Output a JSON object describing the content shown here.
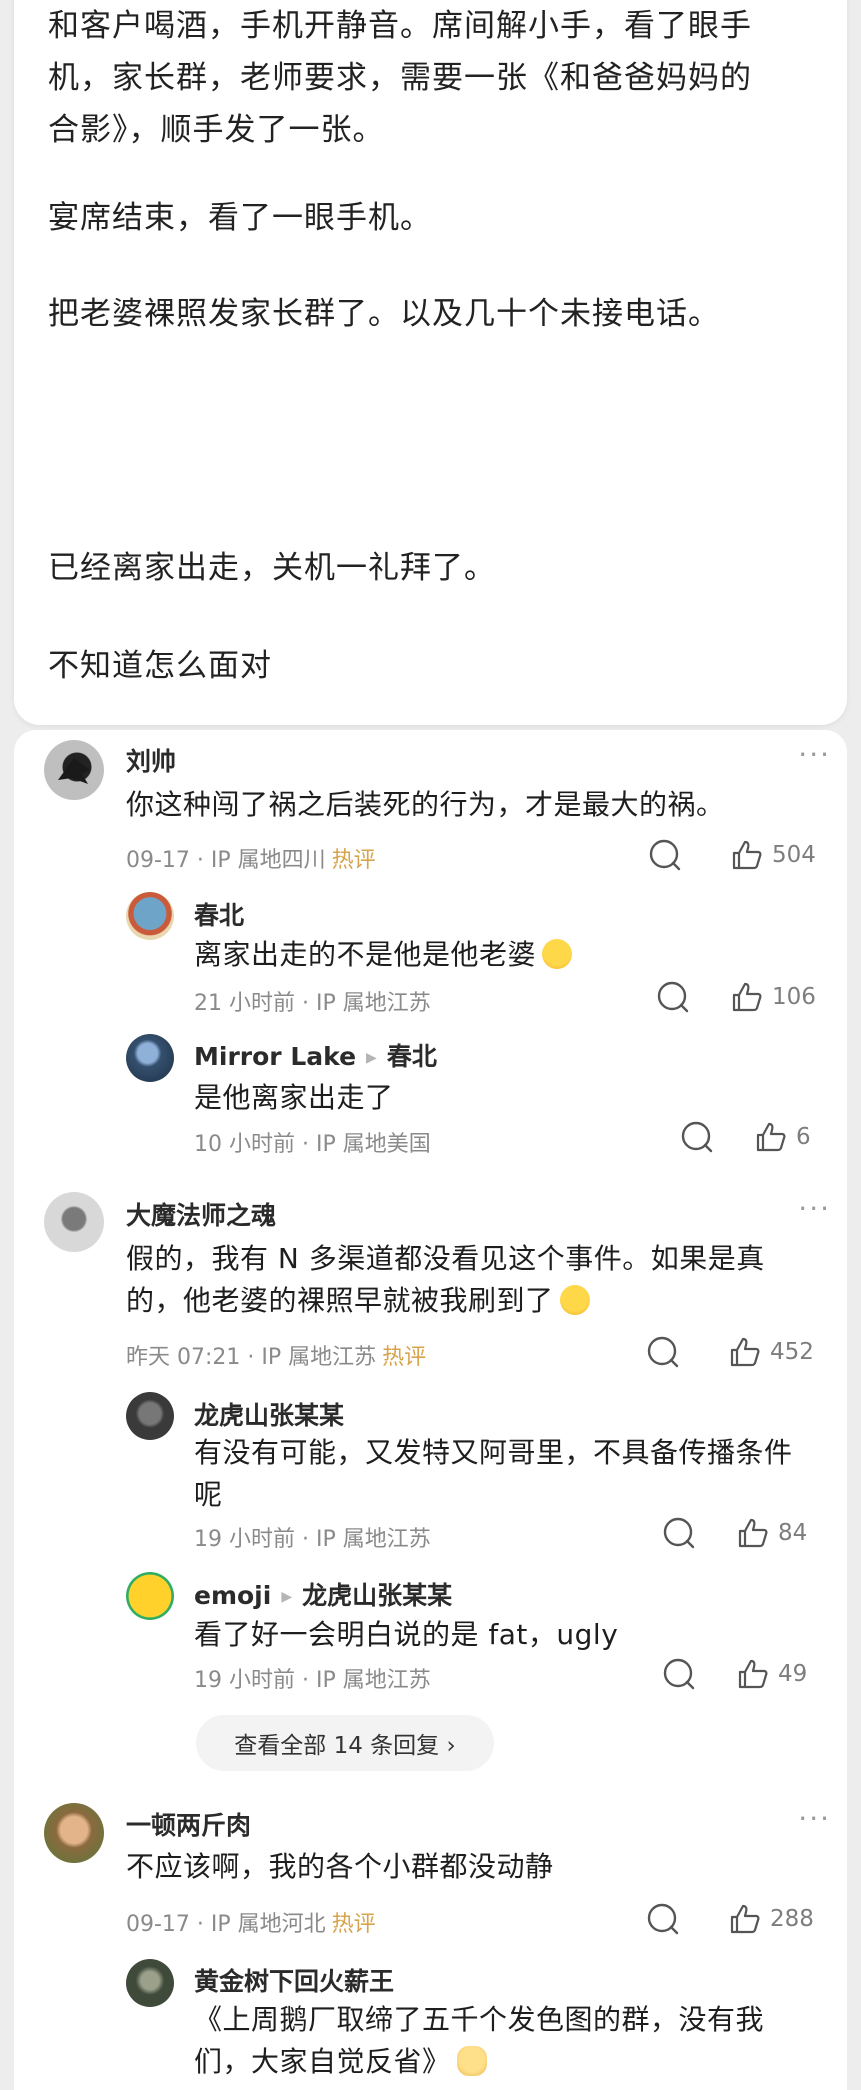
{
  "post": {
    "paragraphs": [
      [
        "和客户喝酒，手机开静音。席间解小手，看了眼手",
        "机，家长群，老师要求，需要一张《和爸爸妈妈的",
        "合影》，顺手发了一张。"
      ],
      [
        "宴席结束，看了一眼手机。"
      ],
      [
        "把老婆裸照发家长群了。以及几十个未接电话。"
      ],
      [
        "已经离家出走，关机一礼拜了。"
      ],
      [
        "不知道怎么面对"
      ]
    ]
  },
  "comments": [
    {
      "user": "刘帅",
      "text": [
        "你这种闯了祸之后装死的行为，才是最大的祸。"
      ],
      "time": "09-17 · IP 属地四川",
      "hot": "热评",
      "likes": "504",
      "avatar_color": "#5a5a5a",
      "replies": [
        {
          "user": "春北",
          "reply_to": "",
          "text": [
            "离家出走的不是他是他老婆"
          ],
          "emoji": "laugh-cry",
          "time": "21 小时前 · IP 属地江苏",
          "likes": "106",
          "avatar_color": "#6fa4c9"
        },
        {
          "user": "Mirror Lake",
          "reply_to": "春北",
          "text": [
            "是他离家出走了"
          ],
          "emoji": "",
          "time": "10 小时前 · IP 属地美国",
          "likes": "6",
          "avatar_color": "#34506e"
        }
      ]
    },
    {
      "user": "大魔法师之魂",
      "text": [
        "假的，我有 N 多渠道都没看见这个事件。如果是真",
        "的，他老婆的裸照早就被我刷到了"
      ],
      "emoji": "drool",
      "time": "昨天 07:21 · IP 属地江苏",
      "hot": "热评",
      "likes": "452",
      "avatar_color": "#c9c9c9",
      "replies": [
        {
          "user": "龙虎山张某某",
          "reply_to": "",
          "text": [
            "有没有可能，又发特又阿哥里，不具备传播条件",
            "呢"
          ],
          "emoji": "",
          "time": "19 小时前 · IP 属地江苏",
          "likes": "84",
          "avatar_color": "#4e4e4e"
        },
        {
          "user": "emoji",
          "reply_to": "龙虎山张某某",
          "text": [
            "看了好一会明白说的是 fat，ugly"
          ],
          "emoji": "",
          "time": "19 小时前 · IP 属地江苏",
          "likes": "49",
          "avatar_color": "#f2c21b"
        }
      ],
      "view_all": "查看全部 14 条回复 ›"
    },
    {
      "user": "一顿两斤肉",
      "text": [
        "不应该啊，我的各个小群都没动静"
      ],
      "time": "09-17 · IP 属地河北",
      "hot": "热评",
      "likes": "288",
      "avatar_color": "#8a6a3e",
      "replies": [
        {
          "user": "黄金树下回火薪王",
          "reply_to": "",
          "text": [
            "《上周鹅厂取缔了五千个发色图的群，没有我",
            "们，大家自觉反省》"
          ],
          "emoji": "cat",
          "time": "",
          "likes": "",
          "avatar_color": "#3f4a3a"
        }
      ]
    }
  ],
  "more_label": "···"
}
